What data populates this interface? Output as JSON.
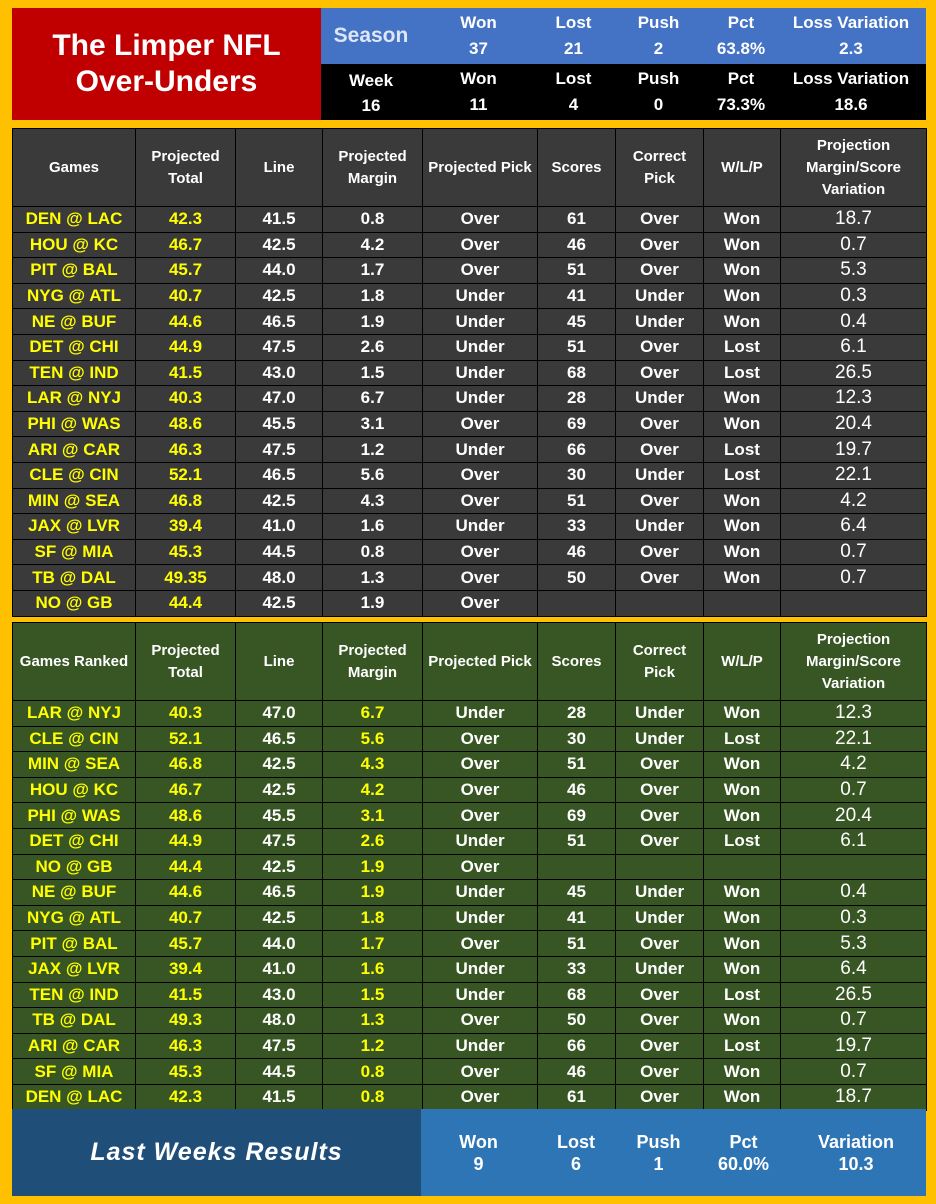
{
  "title": "The Limper NFL\nOver-Unders",
  "season": {
    "label": "Season",
    "won_label": "Won",
    "won": "37",
    "lost_label": "Lost",
    "lost": "21",
    "push_label": "Push",
    "push": "2",
    "pct_label": "Pct",
    "pct": "63.8%",
    "lv_label": "Loss Variation",
    "lv": "2.3"
  },
  "week": {
    "label": "Week",
    "number": "16",
    "won_label": "Won",
    "won": "11",
    "lost_label": "Lost",
    "lost": "4",
    "push_label": "Push",
    "push": "0",
    "pct_label": "Pct",
    "pct": "73.3%",
    "lv_label": "Loss Variation",
    "lv": "18.6"
  },
  "colors": {
    "background": "#FFC000",
    "title_bg": "#C00000",
    "season_bg": "#4472C4",
    "table1_bg": "#3A3A3A",
    "table2_bg": "#375623",
    "highlight": "#FFFF00",
    "footer_left": "#1F4E79",
    "footer_right": "#2E75B6"
  },
  "table1": {
    "headers": [
      "Games",
      "Projected Total",
      "Line",
      "Projected Margin",
      "Projected Pick",
      "Scores",
      "Correct Pick",
      "W/L/P",
      "Projection Margin/Score Variation"
    ],
    "rows": [
      [
        "DEN @ LAC",
        "42.3",
        "41.5",
        "0.8",
        "Over",
        "61",
        "Over",
        "Won",
        "18.7"
      ],
      [
        "HOU @ KC",
        "46.7",
        "42.5",
        "4.2",
        "Over",
        "46",
        "Over",
        "Won",
        "0.7"
      ],
      [
        "PIT @ BAL",
        "45.7",
        "44.0",
        "1.7",
        "Over",
        "51",
        "Over",
        "Won",
        "5.3"
      ],
      [
        "NYG @ ATL",
        "40.7",
        "42.5",
        "1.8",
        "Under",
        "41",
        "Under",
        "Won",
        "0.3"
      ],
      [
        "NE @ BUF",
        "44.6",
        "46.5",
        "1.9",
        "Under",
        "45",
        "Under",
        "Won",
        "0.4"
      ],
      [
        "DET @ CHI",
        "44.9",
        "47.5",
        "2.6",
        "Under",
        "51",
        "Over",
        "Lost",
        "6.1"
      ],
      [
        "TEN @ IND",
        "41.5",
        "43.0",
        "1.5",
        "Under",
        "68",
        "Over",
        "Lost",
        "26.5"
      ],
      [
        "LAR @ NYJ",
        "40.3",
        "47.0",
        "6.7",
        "Under",
        "28",
        "Under",
        "Won",
        "12.3"
      ],
      [
        "PHI @ WAS",
        "48.6",
        "45.5",
        "3.1",
        "Over",
        "69",
        "Over",
        "Won",
        "20.4"
      ],
      [
        "ARI @ CAR",
        "46.3",
        "47.5",
        "1.2",
        "Under",
        "66",
        "Over",
        "Lost",
        "19.7"
      ],
      [
        "CLE @ CIN",
        "52.1",
        "46.5",
        "5.6",
        "Over",
        "30",
        "Under",
        "Lost",
        "22.1"
      ],
      [
        "MIN @ SEA",
        "46.8",
        "42.5",
        "4.3",
        "Over",
        "51",
        "Over",
        "Won",
        "4.2"
      ],
      [
        "JAX @ LVR",
        "39.4",
        "41.0",
        "1.6",
        "Under",
        "33",
        "Under",
        "Won",
        "6.4"
      ],
      [
        "SF @ MIA",
        "45.3",
        "44.5",
        "0.8",
        "Over",
        "46",
        "Over",
        "Won",
        "0.7"
      ],
      [
        "TB @ DAL",
        "49.35",
        "48.0",
        "1.3",
        "Over",
        "50",
        "Over",
        "Won",
        "0.7"
      ],
      [
        "NO @ GB",
        "44.4",
        "42.5",
        "1.9",
        "Over",
        "",
        "",
        "",
        ""
      ]
    ]
  },
  "table2": {
    "headers": [
      "Games Ranked",
      "Projected Total",
      "Line",
      "Projected Margin",
      "Projected Pick",
      "Scores",
      "Correct Pick",
      "W/L/P",
      "Projection Margin/Score Variation"
    ],
    "rows": [
      [
        "LAR @ NYJ",
        "40.3",
        "47.0",
        "6.7",
        "Under",
        "28",
        "Under",
        "Won",
        "12.3"
      ],
      [
        "CLE @ CIN",
        "52.1",
        "46.5",
        "5.6",
        "Over",
        "30",
        "Under",
        "Lost",
        "22.1"
      ],
      [
        "MIN @ SEA",
        "46.8",
        "42.5",
        "4.3",
        "Over",
        "51",
        "Over",
        "Won",
        "4.2"
      ],
      [
        "HOU @ KC",
        "46.7",
        "42.5",
        "4.2",
        "Over",
        "46",
        "Over",
        "Won",
        "0.7"
      ],
      [
        "PHI @ WAS",
        "48.6",
        "45.5",
        "3.1",
        "Over",
        "69",
        "Over",
        "Won",
        "20.4"
      ],
      [
        "DET @ CHI",
        "44.9",
        "47.5",
        "2.6",
        "Under",
        "51",
        "Over",
        "Lost",
        "6.1"
      ],
      [
        "NO @ GB",
        "44.4",
        "42.5",
        "1.9",
        "Over",
        "",
        "",
        "",
        ""
      ],
      [
        "NE @ BUF",
        "44.6",
        "46.5",
        "1.9",
        "Under",
        "45",
        "Under",
        "Won",
        "0.4"
      ],
      [
        "NYG @ ATL",
        "40.7",
        "42.5",
        "1.8",
        "Under",
        "41",
        "Under",
        "Won",
        "0.3"
      ],
      [
        "PIT @ BAL",
        "45.7",
        "44.0",
        "1.7",
        "Over",
        "51",
        "Over",
        "Won",
        "5.3"
      ],
      [
        "JAX @ LVR",
        "39.4",
        "41.0",
        "1.6",
        "Under",
        "33",
        "Under",
        "Won",
        "6.4"
      ],
      [
        "TEN @ IND",
        "41.5",
        "43.0",
        "1.5",
        "Under",
        "68",
        "Over",
        "Lost",
        "26.5"
      ],
      [
        "TB @ DAL",
        "49.3",
        "48.0",
        "1.3",
        "Over",
        "50",
        "Over",
        "Won",
        "0.7"
      ],
      [
        "ARI @ CAR",
        "46.3",
        "47.5",
        "1.2",
        "Under",
        "66",
        "Over",
        "Lost",
        "19.7"
      ],
      [
        "SF @ MIA",
        "45.3",
        "44.5",
        "0.8",
        "Over",
        "46",
        "Over",
        "Won",
        "0.7"
      ],
      [
        "DEN @ LAC",
        "42.3",
        "41.5",
        "0.8",
        "Over",
        "61",
        "Over",
        "Won",
        "18.7"
      ]
    ]
  },
  "footer": {
    "label": "Last Weeks Results",
    "won_label": "Won",
    "won": "9",
    "lost_label": "Lost",
    "lost": "6",
    "push_label": "Push",
    "push": "1",
    "pct_label": "Pct",
    "pct": "60.0%",
    "var_label": "Variation",
    "var": "10.3"
  }
}
